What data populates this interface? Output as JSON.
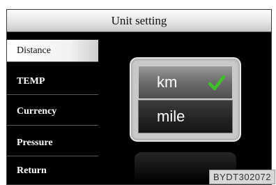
{
  "title": "Unit setting",
  "menu": [
    {
      "label": "Distance",
      "selected": true
    },
    {
      "label": "TEMP",
      "selected": false
    },
    {
      "label": "Currency",
      "selected": false
    },
    {
      "label": "Pressure",
      "selected": false
    },
    {
      "label": "Return",
      "selected": false
    }
  ],
  "options": [
    {
      "label": "km",
      "checked": true
    },
    {
      "label": "mile",
      "checked": false
    }
  ],
  "watermark": "BYDT302072",
  "colors": {
    "check": "#3fbf2a",
    "background": "#000000"
  }
}
